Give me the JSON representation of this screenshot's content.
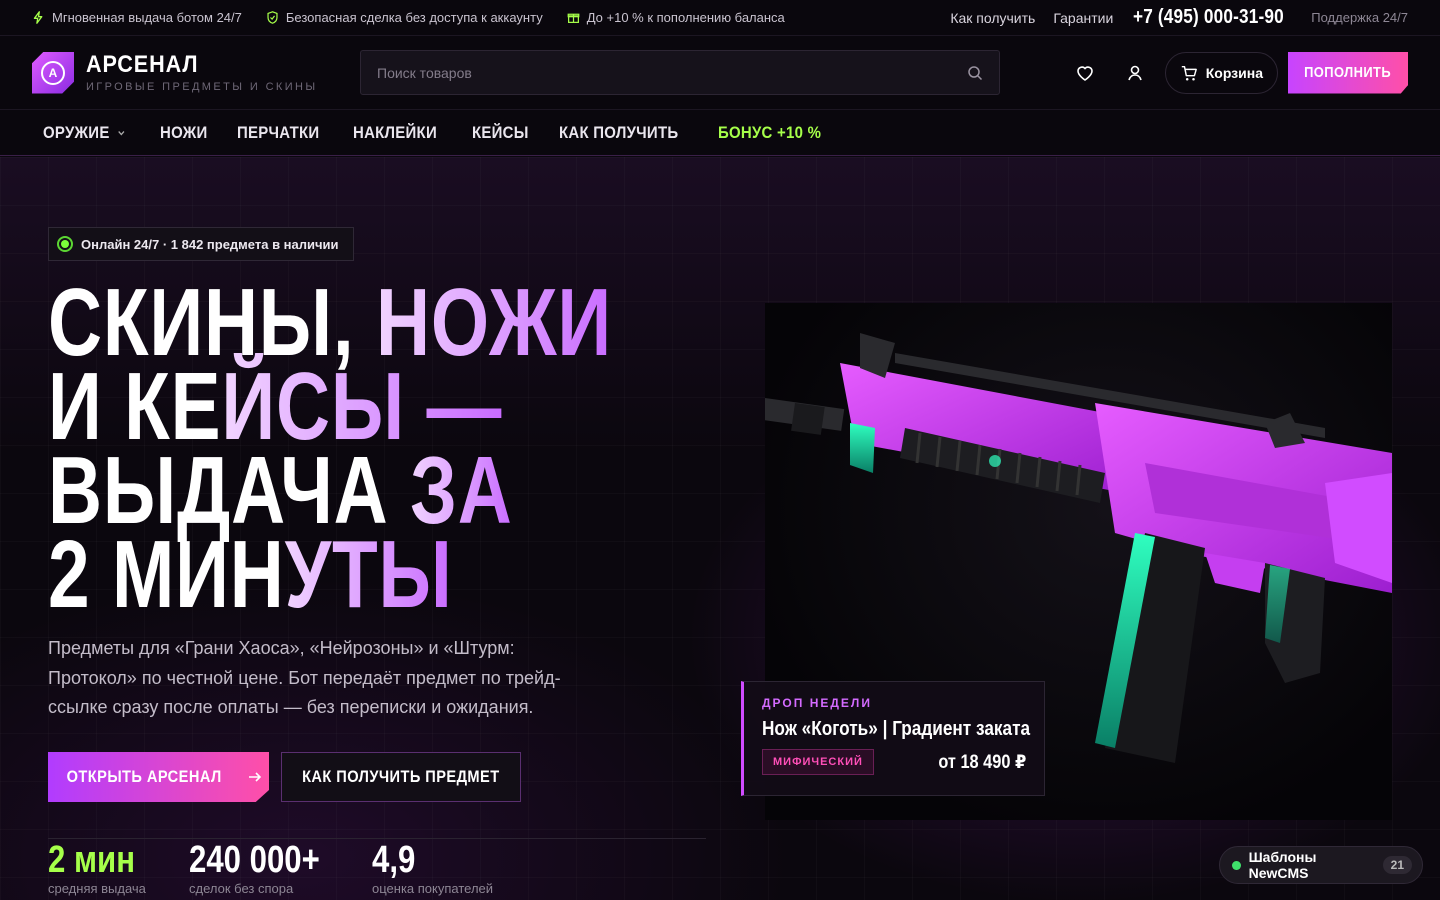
{
  "topbar": {
    "perks": [
      {
        "icon": "bolt-icon",
        "text": "Мгновенная выдача ботом 24/7"
      },
      {
        "icon": "shield-check-icon",
        "text": "Безопасная сделка без доступа к аккаунту"
      },
      {
        "icon": "gift-icon",
        "text": "До +10 % к пополнению баланса"
      }
    ],
    "links": [
      "Как получить",
      "Гарантии"
    ],
    "phone": "+7 (495) 000-31-90",
    "support": "Поддержка 24/7"
  },
  "header": {
    "logo_mark": "A",
    "brand": "АРСЕНАЛ",
    "tagline": "ИГРОВЫЕ ПРЕДМЕТЫ И СКИНЫ",
    "search_placeholder": "Поиск товаров",
    "cart_label": "Корзина",
    "topup_label": "ПОПОЛНИТЬ"
  },
  "nav": {
    "items": [
      "ОРУЖИЕ",
      "НОЖИ",
      "ПЕРЧАТКИ",
      "НАКЛЕЙКИ",
      "КЕЙСЫ",
      "КАК ПОЛУЧИТЬ"
    ],
    "bonus": "БОНУС +10 %"
  },
  "hero": {
    "status": "Онлайн 24/7 · 1 842 предмета в наличии",
    "title": {
      "l1a": "СКИНЫ, ",
      "l1b": "НОЖИ",
      "l2a": "И КЕ",
      "l2b": "ЙСЫ —",
      "l3a": "ВЫДАЧА ",
      "l3b": "ЗА",
      "l4a": "2 МИН",
      "l4b": "УТЫ"
    },
    "lead": "Предметы для «Грани Хаоса», «Нейрозоны» и «Штурм: Протокол» по честной цене. Бот передаёт предмет по трейд-ссылке сразу после оплаты — без переписки и ожидания.",
    "primary_cta": "ОТКРЫТЬ АРСЕНАЛ",
    "secondary_cta": "КАК ПОЛУЧИТЬ ПРЕДМЕТ",
    "stats": [
      {
        "value": "2 мин",
        "caption": "средняя выдача",
        "color": "#a6ff4a"
      },
      {
        "value": "240 000+",
        "caption": "сделок без спора",
        "color": "#ffffff"
      },
      {
        "value": "4,9",
        "caption": "оценка покупателей",
        "color": "#ffffff"
      }
    ]
  },
  "drop": {
    "kicker": "ДРОП НЕДЕЛИ",
    "name": "Нож «Коготь» | Градиент заката",
    "rarity": "МИФИЧЕСКИЙ",
    "price": "от 18 490 ₽"
  },
  "chip": {
    "label": "Шаблоны NewCMS",
    "count": "21"
  },
  "colors": {
    "accent": "#c744ff",
    "accent2": "#ff4fa8",
    "green": "#a6ff4a",
    "bg": "#0a070d"
  }
}
